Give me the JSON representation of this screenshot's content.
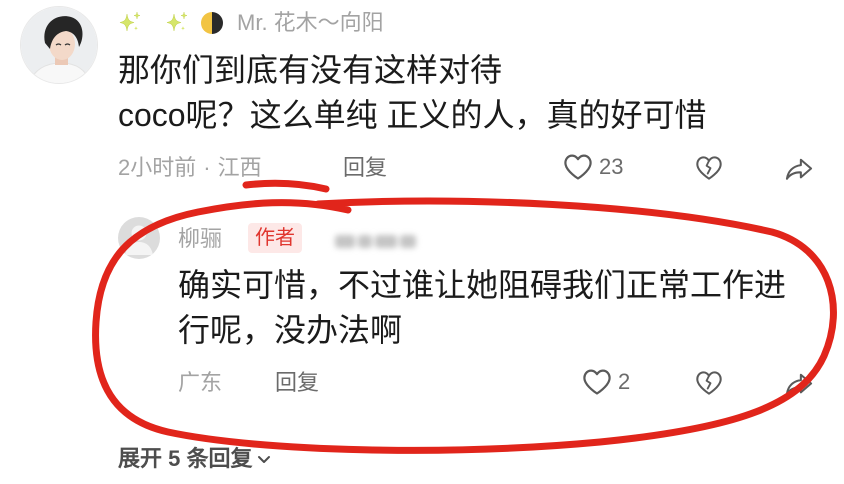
{
  "colors": {
    "annotation_red": "#e1251b",
    "author_badge_bg": "#fde8e7",
    "author_badge_text": "#e0362f",
    "meta_gray": "#a3a3a3",
    "body_text": "#1b1b1b",
    "sparkle_green": "#d6e66a",
    "moon_yellow": "#f2c443"
  },
  "comment": {
    "user_decorations": [
      "sparkles-icon",
      "sparkles-icon",
      "moon-icon"
    ],
    "username": "Mr. 花木～向阳",
    "text_lines": [
      "那你们到底有没有这样对待",
      "coco呢？这么单纯 正义的人，真的好可惜"
    ],
    "time": "2小时前",
    "meta_separator": "·",
    "location": "江西",
    "reply_label": "回复",
    "like_count": "23",
    "action_icons": [
      "heart-icon",
      "broken-heart-icon",
      "share-icon"
    ]
  },
  "reply": {
    "avatar_icon": "default-avatar-icon",
    "username": "柳骊",
    "author_badge": "作者",
    "text_lines": [
      "确实可惜，不过谁让她阻碍我们正常工作进",
      "行呢，没办法啊"
    ],
    "location": "广东",
    "reply_label": "回复",
    "like_count": "2",
    "action_icons": [
      "heart-icon",
      "broken-heart-icon",
      "share-icon"
    ]
  },
  "expand": {
    "label": "展开 5 条回复",
    "icon": "chevron-down-icon"
  }
}
